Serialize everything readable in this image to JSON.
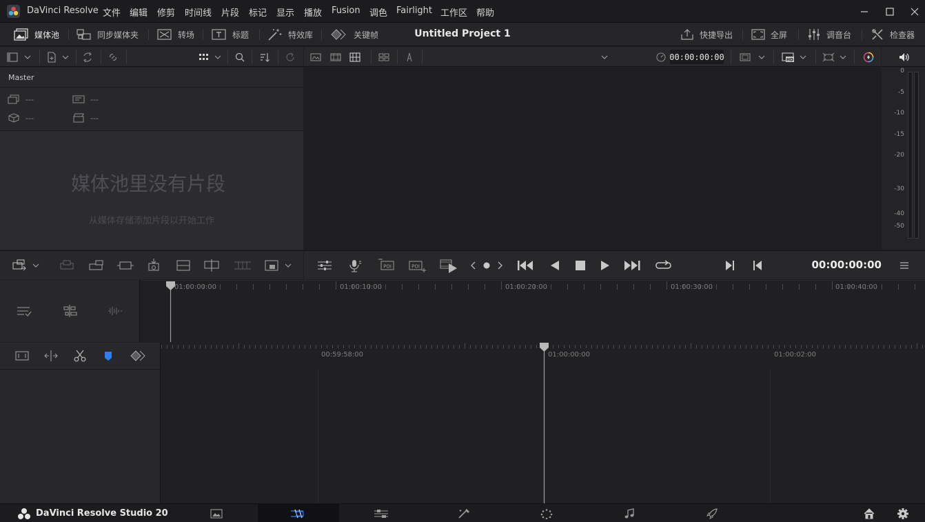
{
  "app": {
    "name": "DaVinci Resolve",
    "menu": [
      "文件",
      "编辑",
      "修剪",
      "时间线",
      "片段",
      "标记",
      "显示",
      "播放",
      "Fusion",
      "调色",
      "Fairlight",
      "工作区",
      "帮助"
    ]
  },
  "toolbar": {
    "media_pool": "媒体池",
    "sync_bin": "同步媒体夹",
    "transitions": "转场",
    "titles": "标题",
    "effects": "特效库",
    "keyframes": "关键帧",
    "project_title": "Untitled Project 1",
    "quick_export": "快捷导出",
    "fullscreen": "全屏",
    "mixer": "调音台",
    "inspector": "检查器"
  },
  "viewer": {
    "timecode_top": "00:00:00:00",
    "timecode_transport": "00:00:00:00"
  },
  "media_pool": {
    "bin": "Master",
    "stats": [
      "---",
      "---",
      "---",
      "---"
    ],
    "empty_title": "媒体池里没有片段",
    "empty_hint": "从媒体存储添加片段以开始工作"
  },
  "meter": {
    "labels": [
      "0",
      "-5",
      "-10",
      "-15",
      "-20",
      "-30",
      "-40",
      "-50"
    ]
  },
  "timeline": {
    "upper_ticks": [
      "01:00:00:00",
      "01:00:10:00",
      "01:00:20:00",
      "01:00:30:00",
      "01:00:40:00"
    ],
    "lower_ticks": [
      "00:59:58:00",
      "01:00:00:00",
      "01:00:02:00"
    ]
  },
  "footer": {
    "brand": "DaVinci Resolve Studio 20"
  },
  "colors": {
    "accent_blue": "#2f7df6",
    "panel": "#28282b",
    "viewer": "#1e1e20"
  }
}
